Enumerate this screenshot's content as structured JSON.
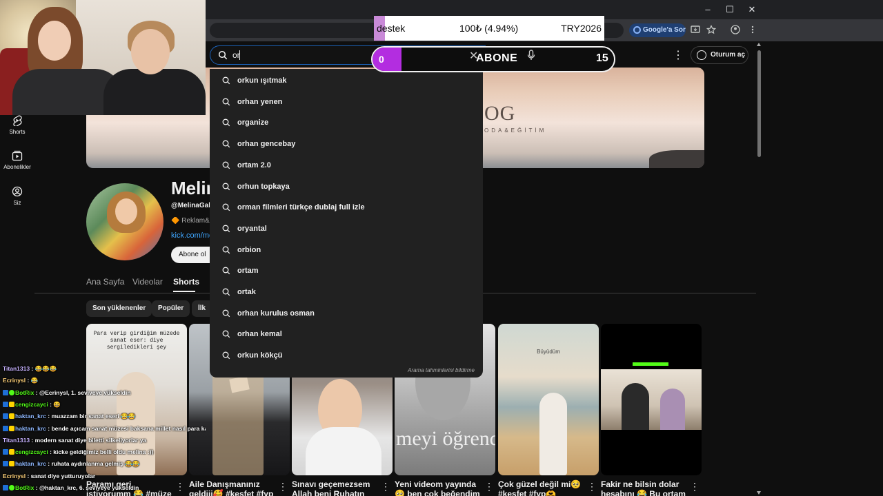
{
  "window": {
    "minimize": "–",
    "maximize": "☐",
    "close": "✕"
  },
  "browser": {
    "google_sor_label": "Google'a Sor"
  },
  "stream_overlay": {
    "donation": {
      "label": "destek",
      "amount": "100₺ (4.94%)",
      "goal": "TRY2026",
      "progress_pct": 4.94,
      "fill_color": "#c98ad8"
    },
    "sub_goal": {
      "current": "0",
      "label": "ABONE",
      "target": "15",
      "fill_color": "#b32de0"
    }
  },
  "search": {
    "query": "or",
    "suggestions": [
      "orkun ışıtmak",
      "orhan yenen",
      "organize",
      "orhan gencebay",
      "ortam 2.0",
      "orhun topkaya",
      "orman filmleri türkçe dublaj full izle",
      "oryantal",
      "orbion",
      "ortam",
      "ortak",
      "orhan kurulus osman",
      "orhan kemal",
      "orkun kökçü"
    ],
    "footer": "Arama tahminlerini bildirme"
  },
  "header": {
    "signin_label": "Oturum aç"
  },
  "rail": {
    "items": [
      {
        "label": "Shorts",
        "icon": "shorts-icon"
      },
      {
        "label": "Abonelikler",
        "icon": "subscriptions-icon"
      },
      {
        "label": "Siz",
        "icon": "you-icon"
      }
    ]
  },
  "banner": {
    "logo": "OG",
    "subtitle": "ODA&EĞİTİM"
  },
  "channel": {
    "name": "Melina",
    "handle": "@MelinaGalit",
    "meta": "🔶 Reklam&İş",
    "link": "kick.com/melina",
    "subscribe_label": "Abone ol"
  },
  "tabs": [
    {
      "label": "Ana Sayfa",
      "active": false
    },
    {
      "label": "Videolar",
      "active": false
    },
    {
      "label": "Shorts",
      "active": true
    }
  ],
  "chips": [
    "Son yüklenenler",
    "Popüler",
    "İlk y"
  ],
  "shorts": [
    {
      "title": "Paramı geri istiyorumm 😂 #müze #travel",
      "overlay": "Para verip girdiğim müzede sanat eser: diye sergiledikleri şey"
    },
    {
      "title": "Aile Danışmanınız geldiii🥰 #keşfet #fyp"
    },
    {
      "title": "Sınavı geçemezsem Allah beni Ruhatın"
    },
    {
      "title": "Yeni videom yayında🥺 ben çok beğendim",
      "overlay": "meyi öğrend"
    },
    {
      "title": "Çok güzel değil mi🥺 #keşfet #fyp🫶",
      "overlay": "Büyüdüm"
    },
    {
      "title": "Fakir ne bilsin dolar hesabını 😂 Bu ortam"
    }
  ],
  "chat": [
    {
      "user": "Titan1313",
      "msg": "😂😂😂",
      "color": "#c7b2ff",
      "badges": []
    },
    {
      "user": "Ecrinysl",
      "msg": "😂",
      "color": "#ffd27a",
      "badges": []
    },
    {
      "user": "BotRix",
      "msg": "@Ecrinysl, 1. seviyeye yükseldin",
      "color": "#53fc18",
      "badges": [
        "b",
        "g"
      ]
    },
    {
      "user": "cengizcayci",
      "msg": "😆",
      "color": "#53fc18",
      "badges": [
        "b",
        "y"
      ]
    },
    {
      "user": "haktan_krc",
      "msg": "muazzam bir sanat eseri 😂😂",
      "color": "#8fb8ff",
      "badges": [
        "b",
        "y"
      ]
    },
    {
      "user": "haktan_krc",
      "msg": "bende açıcam sanat müzesi baksana millet nasıl para kazanıyor 😂😂",
      "color": "#8fb8ff",
      "badges": [
        "b",
        "y"
      ]
    },
    {
      "user": "Titan1313",
      "msg": "modern sanat diye biletti silkeliyorlar ya",
      "color": "#c7b2ff",
      "badges": []
    },
    {
      "user": "cengizcayci",
      "msg": "kicke geldiğimiz belli oldu melina :))",
      "color": "#53fc18",
      "badges": [
        "b",
        "y"
      ]
    },
    {
      "user": "haktan_krc",
      "msg": "ruhata aydınlanma gelmiş 😂😂",
      "color": "#8fb8ff",
      "badges": [
        "b",
        "y"
      ]
    },
    {
      "user": "Ecrinysl",
      "msg": "sanat diye yutturuyolar",
      "color": "#ffd27a",
      "badges": []
    },
    {
      "user": "BotRix",
      "msg": "@haktan_krc, 6. seviyeye yükseldin",
      "color": "#53fc18",
      "badges": [
        "b",
        "g"
      ]
    }
  ]
}
